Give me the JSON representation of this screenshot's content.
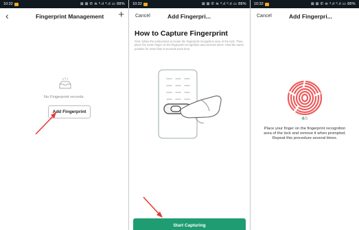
{
  "status": {
    "time": "10:32",
    "icons": "⊠ ⊠ ✆ ≋ ᵈ.ıl ᵈ.ıl ▭",
    "battery": "88%"
  },
  "screen1": {
    "title": "Fingerprint Management",
    "back_icon": "‹",
    "add_icon": "+",
    "empty_text": "No Fingerprint records.",
    "add_button": "Add Fingerprint"
  },
  "screen2": {
    "cancel": "Cancel",
    "title": "Add Fingerpri...",
    "heading": "How to Capture Fingerprint",
    "instructions": "First, follow the instructions to locate the fingerprint recognition area of the lock. Then, place the same finger on the fingerprint recognition area several times. Hold the same position for more than 5 seconds each time.",
    "start_button": "Start Capturing"
  },
  "screen3": {
    "cancel": "Cancel",
    "title": "Add Fingerpri...",
    "progress_current": "4",
    "progress_total": "/5",
    "place_text": "Place your finger on the fingerprint recognition area of the lock and remove it when prompted. Repeat this procedure several times."
  },
  "colors": {
    "accent_green": "#1f9c72",
    "arrow_red": "#e53935",
    "fingerprint_red": "#ee5a5a",
    "statusbar": "#101820"
  }
}
